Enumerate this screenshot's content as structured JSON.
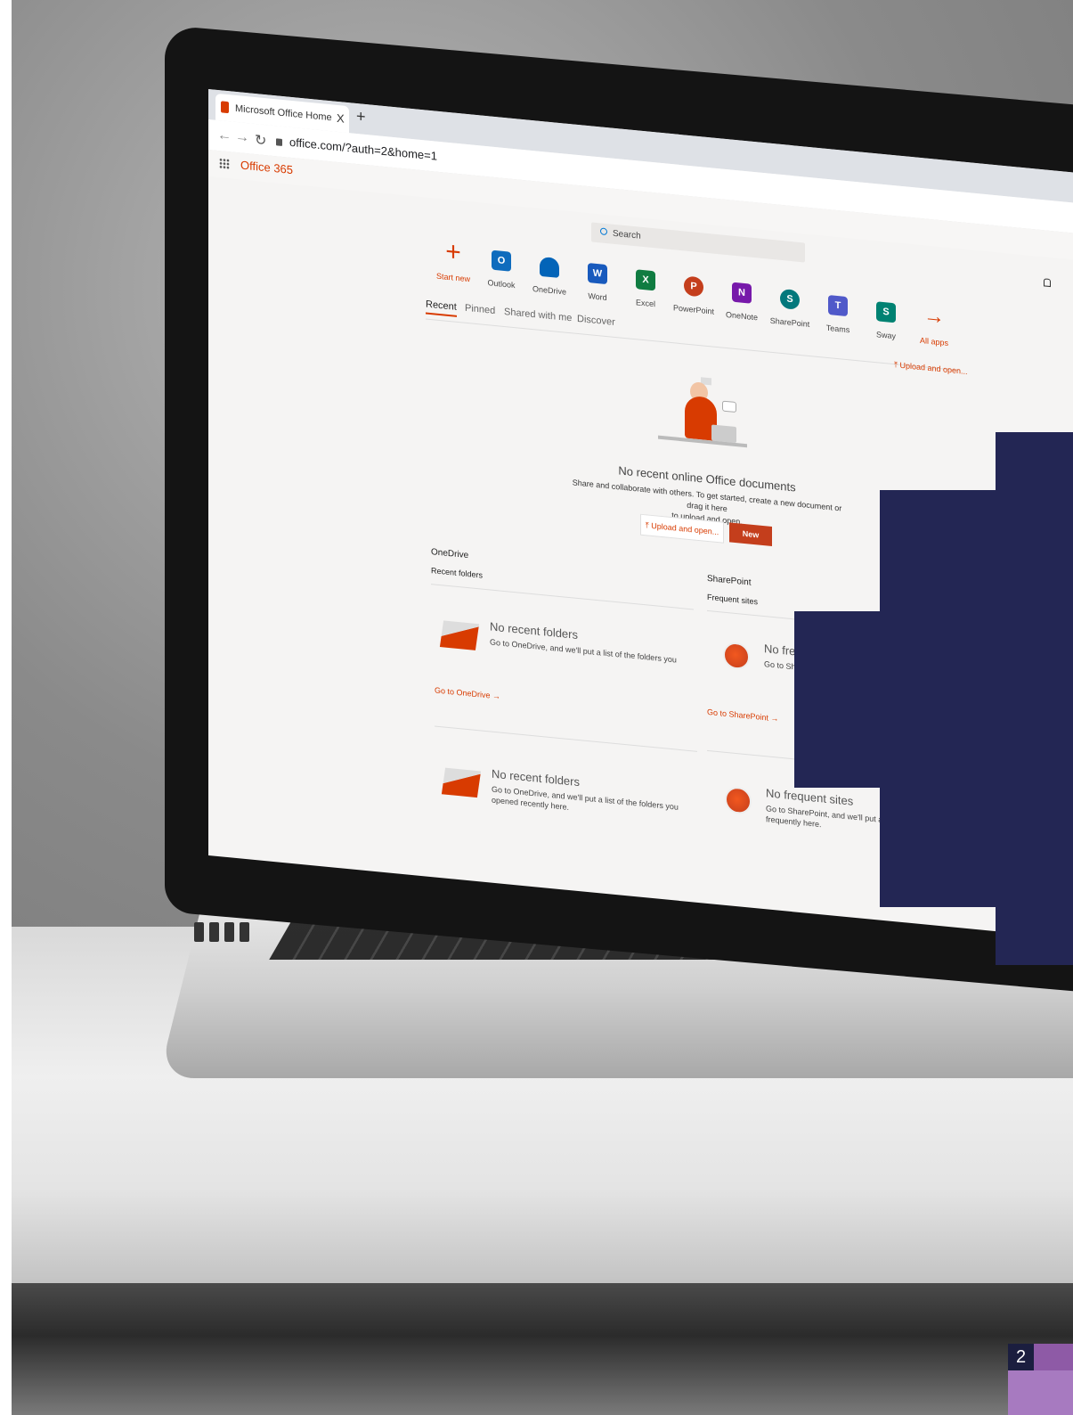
{
  "browser": {
    "tab_title": "Microsoft Office Home",
    "tab_close": "X",
    "new_tab": "+",
    "url": "office.com/?auth=2&home=1"
  },
  "office": {
    "brand": "Office 365",
    "search_placeholder": "Search",
    "apps": [
      {
        "label": "Start new",
        "icon": "plus-icon",
        "color": "#d83b01"
      },
      {
        "label": "Outlook",
        "icon": "outlook-icon",
        "color": "#0f6cbd"
      },
      {
        "label": "OneDrive",
        "icon": "onedrive-icon",
        "color": "#0364b8"
      },
      {
        "label": "Word",
        "icon": "word-icon",
        "color": "#185abd"
      },
      {
        "label": "Excel",
        "icon": "excel-icon",
        "color": "#107c41"
      },
      {
        "label": "PowerPoint",
        "icon": "powerpoint-icon",
        "color": "#c43e1c"
      },
      {
        "label": "OneNote",
        "icon": "onenote-icon",
        "color": "#7719aa"
      },
      {
        "label": "SharePoint",
        "icon": "sharepoint-icon",
        "color": "#03787c"
      },
      {
        "label": "Teams",
        "icon": "teams-icon",
        "color": "#5059c9"
      },
      {
        "label": "Sway",
        "icon": "sway-icon",
        "color": "#008272"
      },
      {
        "label": "All apps",
        "icon": "arrow-right-icon",
        "color": "#d83b01"
      }
    ],
    "doc_tabs": [
      "Recent",
      "Pinned",
      "Shared with me",
      "Discover"
    ],
    "upload_link": "Upload and open...",
    "empty_state": {
      "title": "No recent online Office documents",
      "desc_line1": "Share and collaborate with others. To get started, create a new document or drag it here",
      "desc_line2": "to upload and open.",
      "upload_button": "Upload and open...",
      "new_button": "New"
    },
    "onedrive": {
      "heading": "OneDrive",
      "subheading": "Recent folders",
      "card_title": "No recent folders",
      "card_desc": "Go to OneDrive, and we'll put a list of the folders you",
      "card_desc2": "opened recently here.",
      "link": "Go to OneDrive →"
    },
    "sharepoint": {
      "heading": "SharePoint",
      "subheading": "Frequent sites",
      "card_title": "No frequent sites",
      "card_title_cut": "No frequ",
      "card_desc": "Go to SharePoint, and we'll put a list of the",
      "card_desc_cut": "Go to Share",
      "card_desc2": "frequently here.",
      "link": "Go to SharePoint →"
    }
  },
  "slide": {
    "page_number": "2",
    "accent_navy": "#232654",
    "accent_purple": "#a77ac0"
  }
}
